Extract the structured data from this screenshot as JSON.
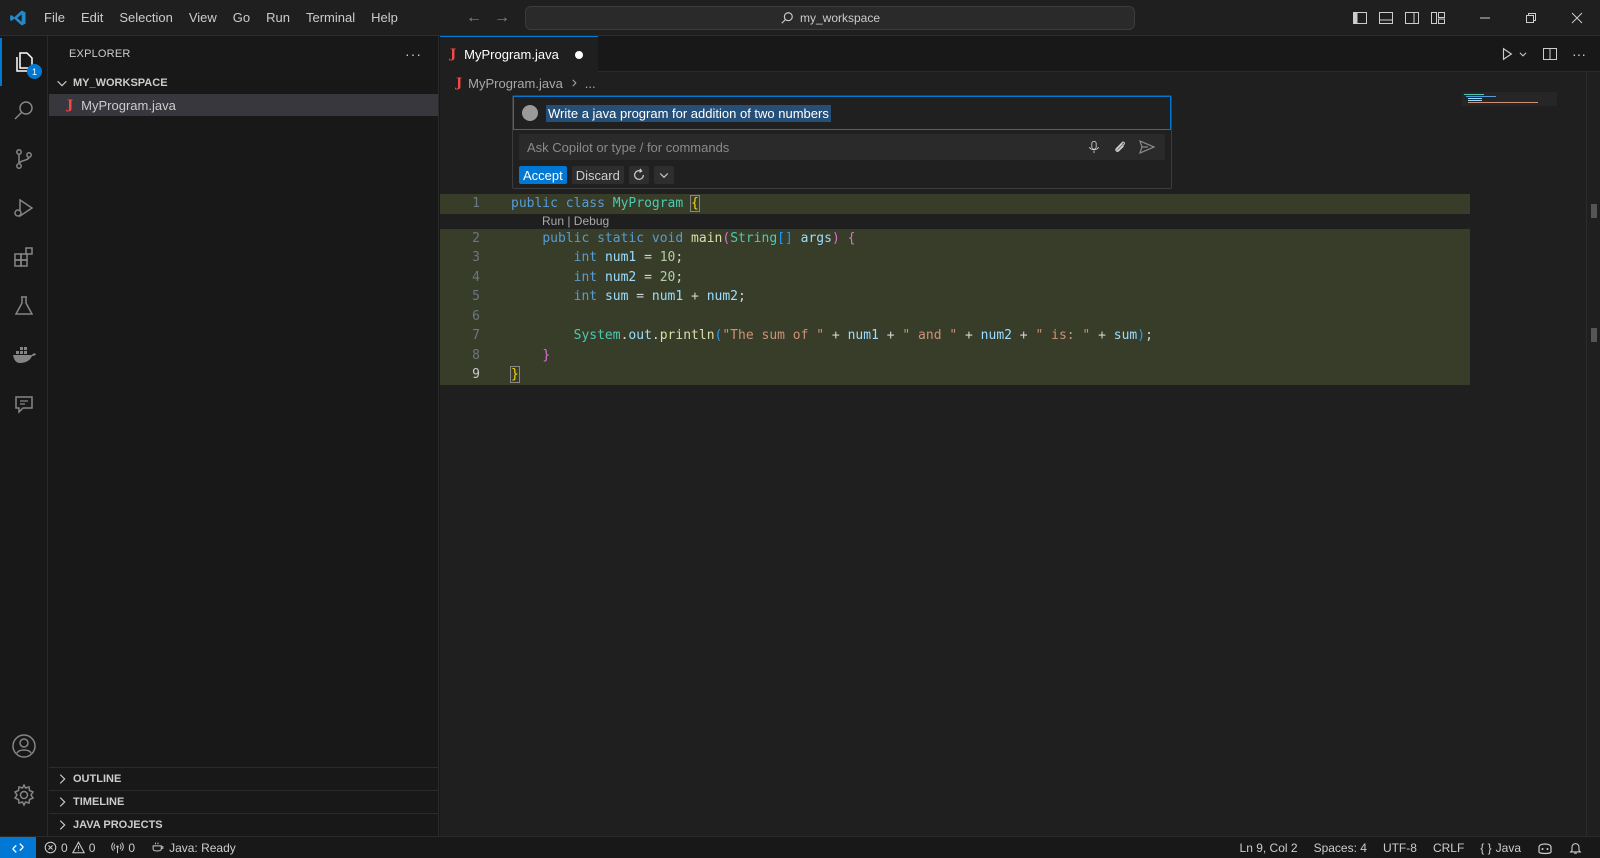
{
  "menu": [
    "File",
    "Edit",
    "Selection",
    "View",
    "Go",
    "Run",
    "Terminal",
    "Help"
  ],
  "command_center": "my_workspace",
  "activity": {
    "explorer_badge": "1"
  },
  "sidebar": {
    "title": "EXPLORER",
    "workspace": "MY_WORKSPACE",
    "file": "MyProgram.java",
    "sections": [
      "OUTLINE",
      "TIMELINE",
      "JAVA PROJECTS"
    ]
  },
  "tab": {
    "label": "MyProgram.java"
  },
  "breadcrumb": {
    "file": "MyProgram.java",
    "rest": "..."
  },
  "copilot": {
    "prompt": "Write a java program for addition of two numbers",
    "placeholder": "Ask Copilot or type / for commands",
    "accept": "Accept",
    "discard": "Discard"
  },
  "code": {
    "line_numbers": [
      "1",
      "2",
      "3",
      "4",
      "5",
      "6",
      "7",
      "8",
      "9"
    ],
    "codelens": "Run | Debug"
  },
  "status": {
    "errors": "0",
    "warnings": "0",
    "ports": "0",
    "java": "Java: Ready",
    "position": "Ln 9, Col 2",
    "spaces": "Spaces: 4",
    "encoding": "UTF-8",
    "eol": "CRLF",
    "language": "Java"
  },
  "colors": {
    "accent": "#0078d4",
    "diff_bg": "#373d29"
  }
}
